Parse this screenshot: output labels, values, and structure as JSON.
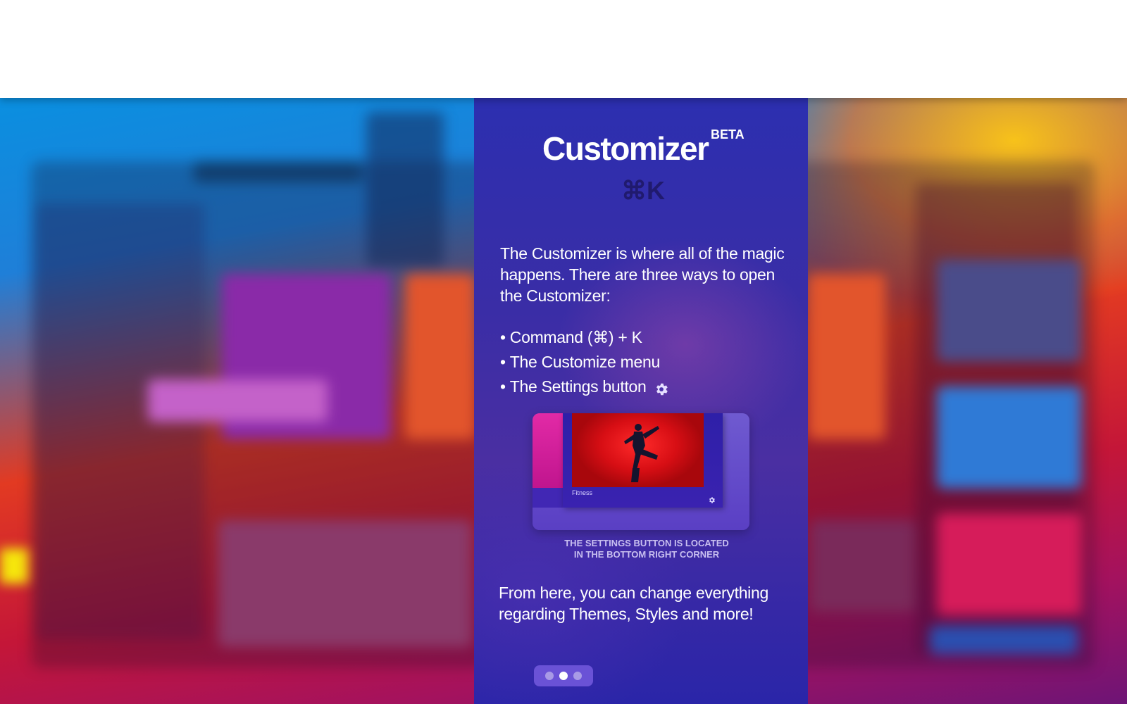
{
  "customizer": {
    "title": "Customizer",
    "badge": "BETA",
    "shortcut": "⌘K",
    "intro": "The Customizer is where all of the magic happens. There are three ways to open the Customizer:",
    "ways": [
      {
        "bullet": "•",
        "label": "Command (⌘) + K"
      },
      {
        "bullet": "•",
        "label": "The Customize menu"
      },
      {
        "bullet": "•",
        "label": "The Settings button",
        "icon": "gear-icon"
      }
    ],
    "preview": {
      "card_label": "Fitness",
      "icon": "gear-icon"
    },
    "caption_line1": "THE SETTINGS BUTTON IS LOCATED",
    "caption_line2": "IN THE BOTTOM RIGHT CORNER",
    "outro": "From here, you can change everything regarding Themes, Styles and more!",
    "pager": {
      "pages": 3,
      "current": 2
    }
  },
  "colors": {
    "panel": "#2f2da8",
    "shortcut": "#201a6e",
    "caption": "#c8bff0",
    "pager": "#6a52d6",
    "preview_photo": "#d70e14"
  }
}
